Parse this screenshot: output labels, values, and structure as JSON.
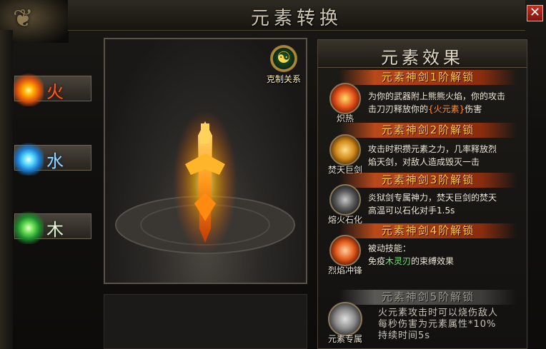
{
  "window": {
    "title": "元素转换",
    "close_label": "✕"
  },
  "elements": [
    {
      "label": "火",
      "color": "#ff5a1e"
    },
    {
      "label": "水",
      "color": "#9ad6ff"
    },
    {
      "label": "木",
      "color": "#f0f0e0"
    }
  ],
  "restraint": {
    "label": "克制关系",
    "icon": "yin-yang-icon"
  },
  "effects": {
    "title": "元素效果",
    "tiers": [
      {
        "head": "元素神剑1阶解锁",
        "icon_caption": "炽热",
        "desc_1": "为你的武器附上熊熊火焰，你的攻击",
        "desc_2a": "击刀刃释放你的",
        "desc_2b": "{火元素}",
        "desc_2c": "伤害"
      },
      {
        "head": "元素神剑2阶解锁",
        "icon_caption": "焚天巨剑",
        "desc_1": "攻击时积攒元素之力，几率释放烈",
        "desc_2": "焰天剑，对敌人造成毁灭一击"
      },
      {
        "head": "元素神剑3阶解锁",
        "icon_caption": "熔火石化",
        "desc_1": "炎狱剑专属神力，焚天巨剑的焚天",
        "desc_2": "高温可以石化对手1.5s"
      },
      {
        "head": "元素神剑4阶解锁",
        "icon_caption": "烈焰冲锋",
        "desc_1": "被动技能：",
        "desc_2a": "免疫",
        "desc_2b": "木灵刃",
        "desc_2c": "的束缚效果"
      },
      {
        "head": "元素神剑5阶解锁",
        "icon_caption": "元素专属",
        "desc_1": "火元素攻击时可以烧伤敌人",
        "desc_2": "每秒伤害为元素属性*10%",
        "desc_3": "持续时间5s"
      }
    ]
  }
}
